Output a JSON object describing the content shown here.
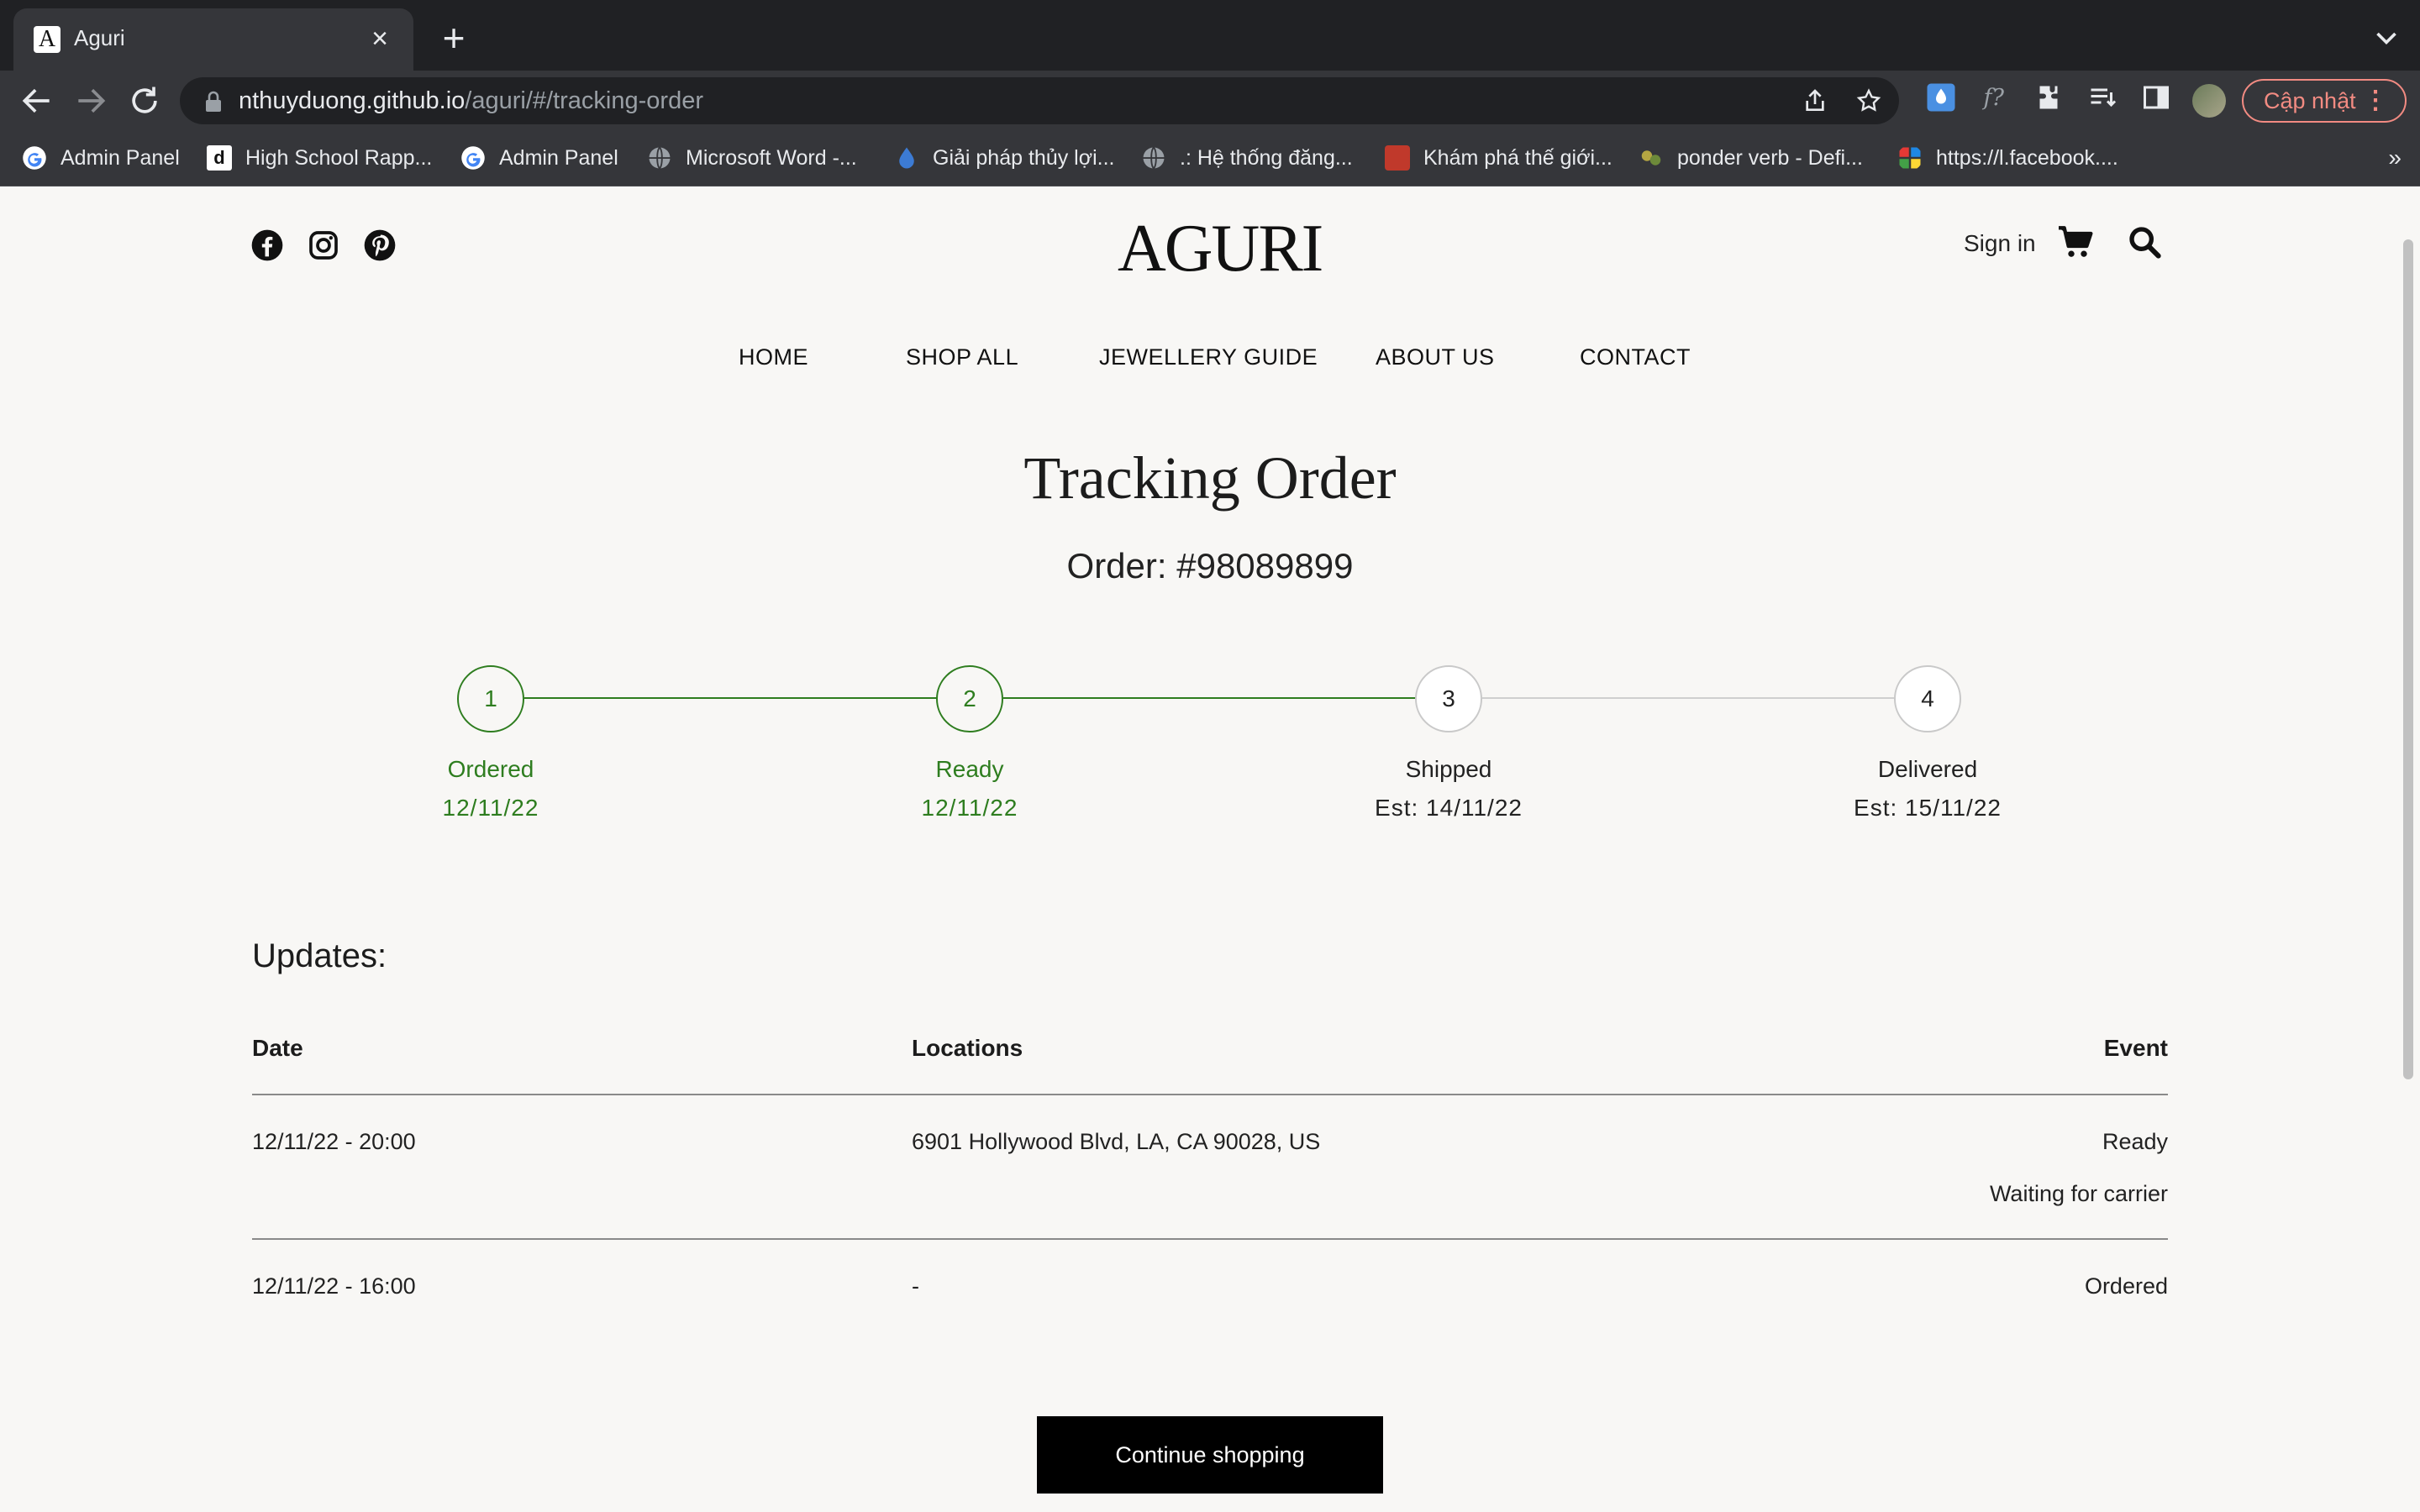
{
  "browser": {
    "tab_title": "Aguri",
    "tab_favicon": "A",
    "url_host": "nthuyduong.github.io",
    "url_path": "/aguri/#/tracking-order",
    "update_label": "Cập nhật",
    "bookmarks": [
      {
        "label": "Admin Panel",
        "icon": "google-icon"
      },
      {
        "label": "High School Rapp...",
        "icon": "d-icon"
      },
      {
        "label": "Admin Panel",
        "icon": "google-icon"
      },
      {
        "label": "Microsoft Word -...",
        "icon": "globe-icon"
      },
      {
        "label": "Giải pháp thủy lợi...",
        "icon": "water-drop-icon"
      },
      {
        "label": ".: Hệ thống đăng...",
        "icon": "globe-icon"
      },
      {
        "label": "Khám phá thế giới...",
        "icon": "red-badge-icon"
      },
      {
        "label": "ponder verb - Defi...",
        "icon": "dictionary-icon"
      },
      {
        "label": "https://l.facebook....",
        "icon": "puzzle-color-icon"
      }
    ]
  },
  "site": {
    "logo": "AGURI",
    "sign_in": "Sign in",
    "menu": [
      "HOME",
      "SHOP ALL",
      "JEWELLERY GUIDE",
      "ABOUT US",
      "CONTACT"
    ]
  },
  "tracking": {
    "title": "Tracking Order",
    "order_label": "Order: #98089899",
    "steps": [
      {
        "number": "1",
        "label": "Ordered",
        "date": "12/11/22",
        "done": true
      },
      {
        "number": "2",
        "label": "Ready",
        "date": "12/11/22",
        "done": true
      },
      {
        "number": "3",
        "label": "Shipped",
        "date": "Est: 14/11/22",
        "done": false
      },
      {
        "number": "4",
        "label": "Delivered",
        "date": "Est: 15/11/22",
        "done": false
      }
    ],
    "progress_color": "#2e7d1f",
    "pending_color": "#c9c9c9"
  },
  "updates": {
    "title": "Updates:",
    "headers": {
      "date": "Date",
      "location": "Locations",
      "event": "Event"
    },
    "rows": [
      {
        "date": "12/11/22 - 20:00",
        "location": "6901 Hollywood Blvd, LA, CA 90028, US",
        "event": "Ready",
        "note": "Waiting for carrier"
      },
      {
        "date": "12/11/22 - 16:00",
        "location": "-",
        "event": "Ordered",
        "note": ""
      }
    ]
  },
  "actions": {
    "continue_shopping": "Continue shopping"
  }
}
